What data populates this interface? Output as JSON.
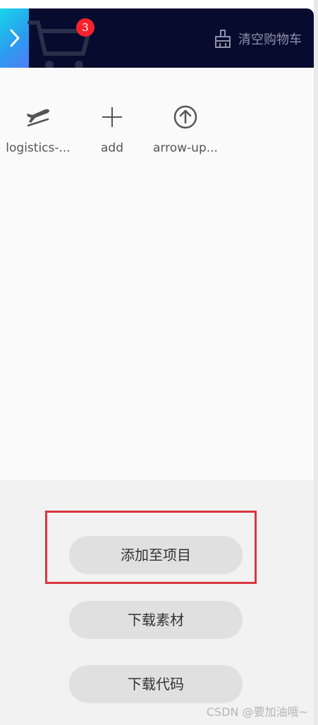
{
  "header": {
    "badge_count": "3",
    "clear_cart_label": "清空购物车",
    "background_color": "#070b2e",
    "badge_color": "#f5222d"
  },
  "items": [
    {
      "name": "logistics-...",
      "icon": "airplane-icon"
    },
    {
      "name": "add",
      "icon": "plus-icon"
    },
    {
      "name": "arrow-up...",
      "icon": "arrow-up-circle-icon"
    }
  ],
  "buttons": {
    "add_to_project": "添加至项目",
    "download_assets": "下载素材",
    "download_code": "下载代码"
  },
  "watermark": "CSDN @要加油哦~"
}
